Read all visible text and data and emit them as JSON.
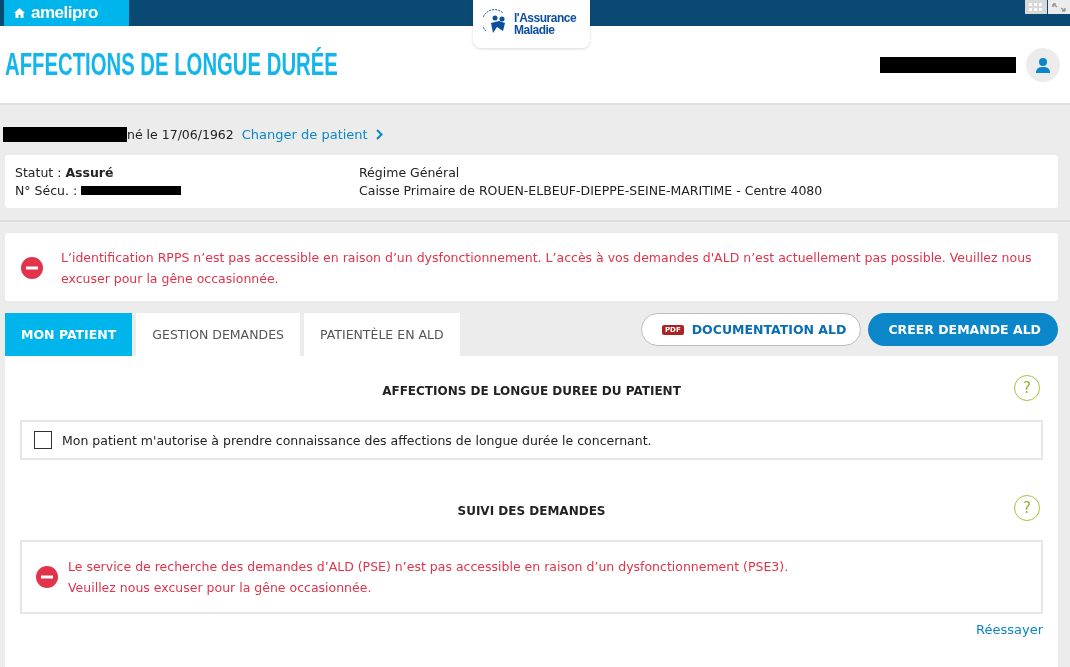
{
  "topbar": {
    "brand": "amelipro",
    "logo": {
      "line1": "l'Assurance",
      "line2": "Maladie"
    }
  },
  "header": {
    "title": "AFFECTIONS DE LONGUE DURÉE"
  },
  "patient": {
    "birth": "né le 17/06/1962",
    "change_link": "Changer de patient"
  },
  "patient_card": {
    "status_label": "Statut :",
    "status_value": "Assuré",
    "secu_label": "N° Sécu. :",
    "regime": "Régime Général",
    "caisse": "Caisse Primaire de ROUEN-ELBEUF-DIEPPE-SEINE-MARITIME - Centre 4080"
  },
  "alert": {
    "message": "L’identification RPPS n’est pas accessible en raison d’un dysfonctionnement. L’accès à vos demandes d'ALD n’est actuellement pas possible. Veuillez nous excuser pour la gêne occasionnée."
  },
  "tabs": [
    {
      "label": "MON PATIENT",
      "selected": true
    },
    {
      "label": "GESTION DEMANDES",
      "selected": false
    },
    {
      "label": "PATIENTÈLE EN ALD",
      "selected": false
    }
  ],
  "actions": {
    "documentation": {
      "badge": "PDF",
      "label": "DOCUMENTATION ALD"
    },
    "create": "CREER DEMANDE ALD"
  },
  "sections": [
    {
      "title": "AFFECTIONS DE LONGUE DUREE DU PATIENT",
      "help": "?",
      "kind": "consent",
      "consent": {
        "label": "Mon patient m'autorise à prendre connaissance des affections de longue durée le concernant.",
        "checked": false
      }
    },
    {
      "title": "SUIVI DES DEMANDES",
      "help": "?",
      "kind": "error",
      "lines": [
        "Le service de recherche des demandes d’ALD (PSE) n’est pas accessible en raison d’un dysfonctionnement (PSE3).",
        "Veuillez nous excuser pour la gêne occasionnée."
      ],
      "retry": "Réessayer"
    }
  ]
}
